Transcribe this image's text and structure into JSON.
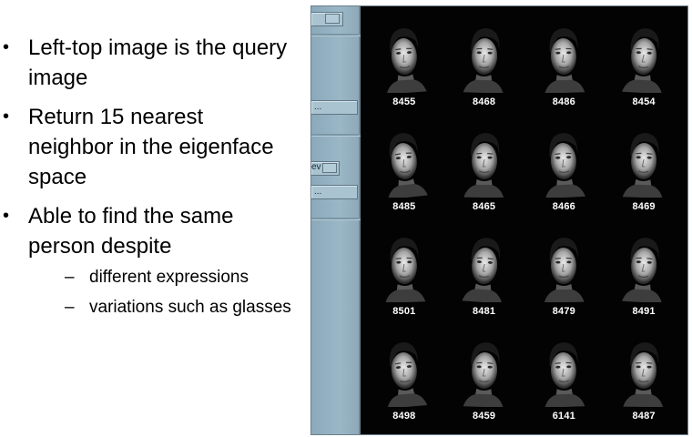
{
  "bullets": [
    {
      "text": "Left-top image is the query image"
    },
    {
      "text": "Return 15 nearest neighbor in the eigenface space"
    },
    {
      "text": "Able to find the same person despite"
    }
  ],
  "sub_bullets": [
    {
      "text": "different expressions"
    },
    {
      "text": "variations such as glasses"
    }
  ],
  "symbols": {
    "bullet": "•",
    "dash": "–"
  },
  "panel": {
    "controls": {
      "dropdown_1_label": "",
      "field_1_label": "...",
      "dropdown_2_label": "ev",
      "field_2_label": "..."
    },
    "results": [
      {
        "id": "8455"
      },
      {
        "id": "8468"
      },
      {
        "id": "8486"
      },
      {
        "id": "8454"
      },
      {
        "id": "8485"
      },
      {
        "id": "8465"
      },
      {
        "id": "8466"
      },
      {
        "id": "8469"
      },
      {
        "id": "8501"
      },
      {
        "id": "8481"
      },
      {
        "id": "8479"
      },
      {
        "id": "8491"
      },
      {
        "id": "8498"
      },
      {
        "id": "8459"
      },
      {
        "id": "6141"
      },
      {
        "id": "8487"
      }
    ]
  },
  "colors": {
    "panel_background": "#030303",
    "control_strip": "#9ab7c6",
    "face_label": "#ffffff"
  }
}
